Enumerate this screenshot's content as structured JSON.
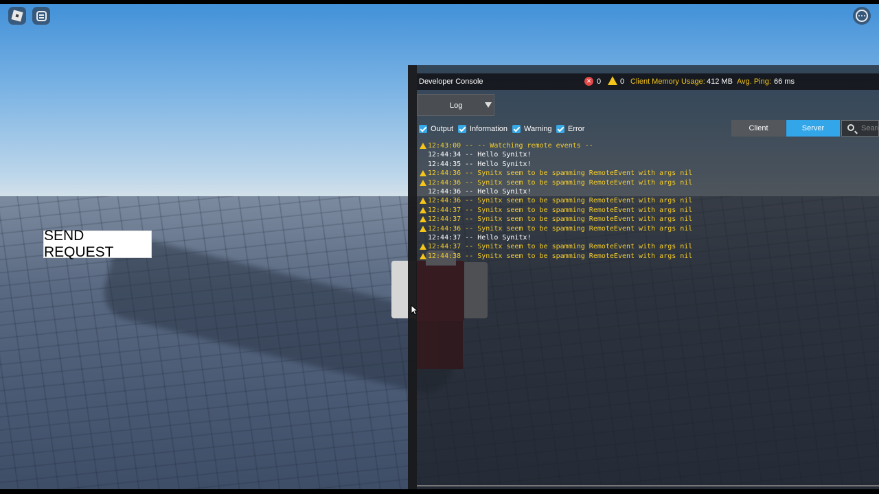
{
  "game": {
    "send_request_label": "SEND REQUEST"
  },
  "topbar": {
    "menu_icon": "roblox-logo-icon",
    "chat_icon": "chat-icon",
    "more_icon": "more-icon"
  },
  "devconsole": {
    "title": "Developer Console",
    "error_count": "0",
    "warning_count": "0",
    "memory_label": "Client Memory Usage:",
    "memory_value": "412 MB",
    "ping_label": "Avg. Ping:",
    "ping_value": "66 ms",
    "dropdown_value": "Log",
    "filters": [
      {
        "label": "Output",
        "checked": true
      },
      {
        "label": "Information",
        "checked": true
      },
      {
        "label": "Warning",
        "checked": true
      },
      {
        "label": "Error",
        "checked": true
      }
    ],
    "tabs": {
      "client": "Client",
      "server": "Server",
      "active": "Server"
    },
    "search_placeholder": "Search",
    "accent_color": "#33a6ea",
    "warning_color": "#f5cd2a",
    "log": [
      {
        "type": "warning",
        "text": "12:43:00 -- -- Watching remote events --"
      },
      {
        "type": "output",
        "text": "12:44:34 -- Hello Synitx!"
      },
      {
        "type": "output",
        "text": "12:44:35 -- Hello Synitx!"
      },
      {
        "type": "warning",
        "text": "12:44:36 -- Synitx seem to be spamming RemoteEvent with args nil"
      },
      {
        "type": "warning",
        "text": "12:44:36 -- Synitx seem to be spamming RemoteEvent with args nil"
      },
      {
        "type": "output",
        "text": "12:44:36 -- Hello Synitx!"
      },
      {
        "type": "warning",
        "text": "12:44:36 -- Synitx seem to be spamming RemoteEvent with args nil"
      },
      {
        "type": "warning",
        "text": "12:44:37 -- Synitx seem to be spamming RemoteEvent with args nil"
      },
      {
        "type": "warning",
        "text": "12:44:37 -- Synitx seem to be spamming RemoteEvent with args nil"
      },
      {
        "type": "warning",
        "text": "12:44:36 -- Synitx seem to be spamming RemoteEvent with args nil"
      },
      {
        "type": "output",
        "text": "12:44:37 -- Hello Synitx!"
      },
      {
        "type": "warning",
        "text": "12:44:37 -- Synitx seem to be spamming RemoteEvent with args nil"
      },
      {
        "type": "warning",
        "text": "12:44:38 -- Synitx seem to be spamming RemoteEvent with args nil"
      }
    ]
  }
}
